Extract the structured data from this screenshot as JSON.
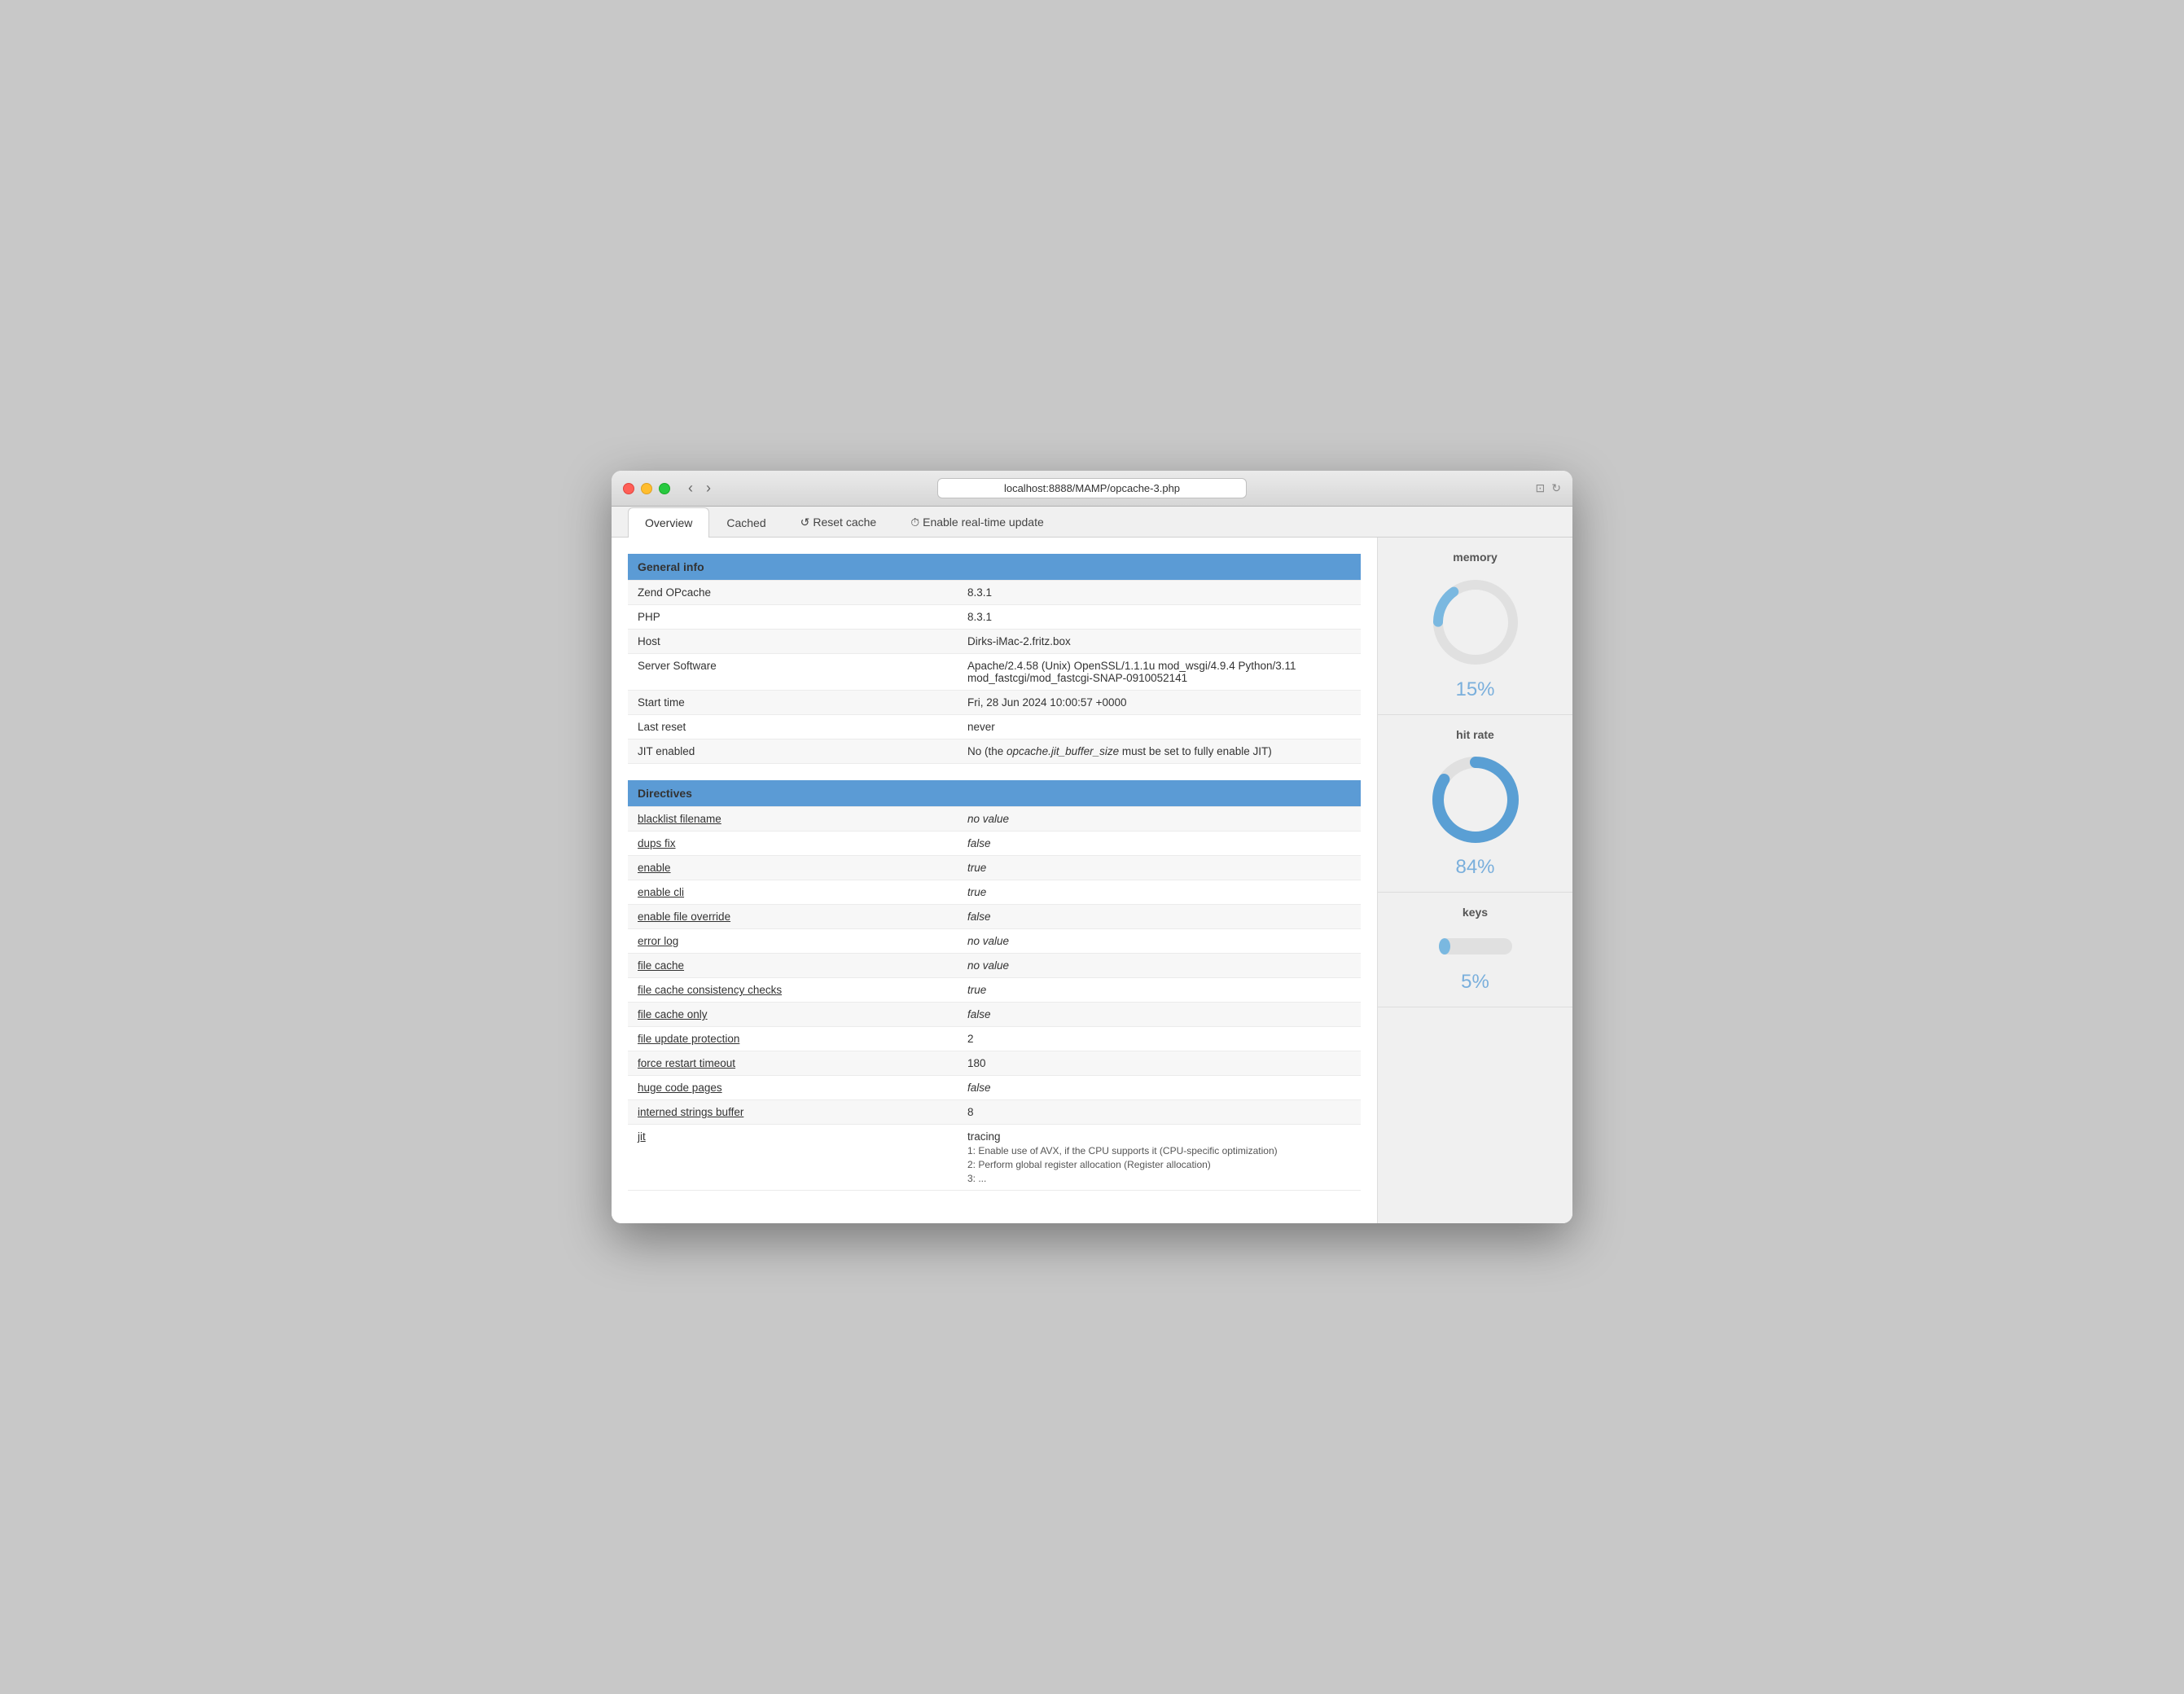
{
  "window": {
    "title": "localhost:8888/MAMP/opcache-3.php",
    "url": "localhost:8888/MAMP/opcache-3.php"
  },
  "tabs": [
    {
      "id": "overview",
      "label": "Overview",
      "active": true,
      "icon": ""
    },
    {
      "id": "cached",
      "label": "Cached",
      "active": false,
      "icon": ""
    },
    {
      "id": "reset-cache",
      "label": "Reset cache",
      "active": false,
      "icon": "↺"
    },
    {
      "id": "enable-realtime",
      "label": "Enable real-time update",
      "active": false,
      "icon": "⏱"
    }
  ],
  "general_info": {
    "section_label": "General info",
    "rows": [
      {
        "key": "Zend OPcache",
        "value": "8.3.1",
        "link": false,
        "italic": false
      },
      {
        "key": "PHP",
        "value": "8.3.1",
        "link": false,
        "italic": false
      },
      {
        "key": "Host",
        "value": "Dirks-iMac-2.fritz.box",
        "link": false,
        "italic": false
      },
      {
        "key": "Server Software",
        "value": "Apache/2.4.58 (Unix) OpenSSL/1.1.1u mod_wsgi/4.9.4 Python/3.11 mod_fastcgi/mod_fastcgi-SNAP-0910052141",
        "link": false,
        "italic": false
      },
      {
        "key": "Start time",
        "value": "Fri, 28 Jun 2024 10:00:57 +0000",
        "link": false,
        "italic": false
      },
      {
        "key": "Last reset",
        "value": "never",
        "link": false,
        "italic": false
      },
      {
        "key": "JIT enabled",
        "value": "No (the opcache.jit_buffer_size must be set to fully enable JIT)",
        "link": false,
        "italic": false,
        "has_italic_part": true
      }
    ]
  },
  "directives": {
    "section_label": "Directives",
    "rows": [
      {
        "key": "blacklist filename",
        "value": "no value",
        "link": true,
        "italic": true
      },
      {
        "key": "dups fix",
        "value": "false",
        "link": true,
        "italic": true
      },
      {
        "key": "enable",
        "value": "true",
        "link": true,
        "italic": true
      },
      {
        "key": "enable cli",
        "value": "true",
        "link": true,
        "italic": true
      },
      {
        "key": "enable file override",
        "value": "false",
        "link": true,
        "italic": true
      },
      {
        "key": "error log",
        "value": "no value",
        "link": true,
        "italic": true
      },
      {
        "key": "file cache",
        "value": "no value",
        "link": true,
        "italic": true
      },
      {
        "key": "file cache consistency checks",
        "value": "true",
        "link": true,
        "italic": true
      },
      {
        "key": "file cache only",
        "value": "false",
        "link": true,
        "italic": true
      },
      {
        "key": "file update protection",
        "value": "2",
        "link": true,
        "italic": false
      },
      {
        "key": "force restart timeout",
        "value": "180",
        "link": true,
        "italic": false
      },
      {
        "key": "huge code pages",
        "value": "false",
        "link": true,
        "italic": true
      },
      {
        "key": "interned strings buffer",
        "value": "8",
        "link": true,
        "italic": false
      },
      {
        "key": "jit",
        "value": "tracing",
        "link": true,
        "italic": false,
        "sub_items": [
          "1: Enable use of AVX, if the CPU supports it (CPU-specific optimization)",
          "2: Perform global register allocation (Register allocation)",
          "3: ..."
        ]
      }
    ]
  },
  "sidebar": {
    "memory": {
      "title": "memory",
      "percent": 15,
      "label": "15%",
      "color": "#7ab8e0"
    },
    "hit_rate": {
      "title": "hit rate",
      "percent": 84,
      "label": "84%",
      "color": "#5a9fd4"
    },
    "keys": {
      "title": "keys",
      "percent": 5,
      "label": "5%",
      "color": "#7ab8e0"
    }
  }
}
